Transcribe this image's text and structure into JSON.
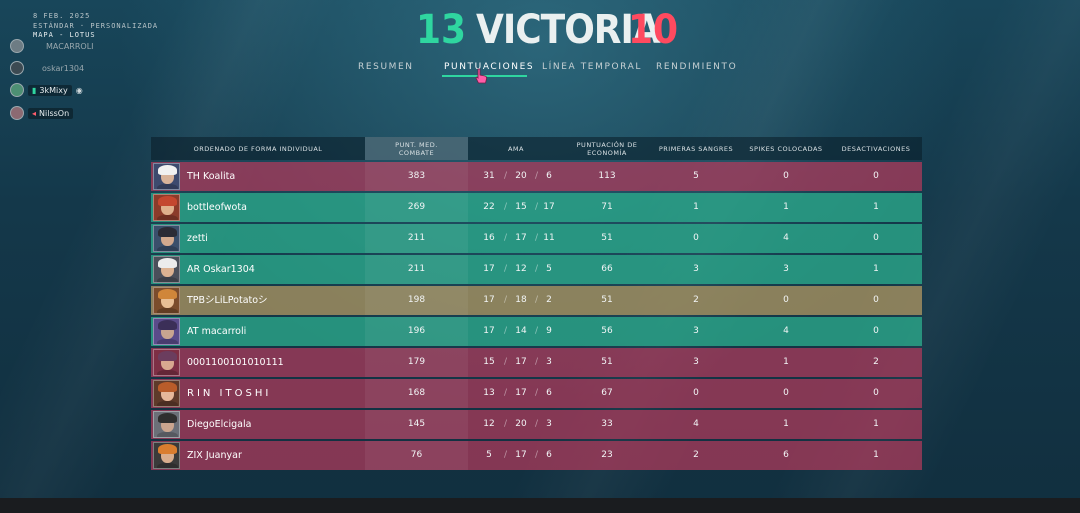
{
  "header": {
    "score_left": "13",
    "result": "VICTORIA",
    "score_right": "10",
    "date": "8 FEB. 2025",
    "mode": "ESTÁNDAR · PERSONALIZADA",
    "map": "MAPA - LOTUS"
  },
  "tabs": [
    {
      "label": "RESUMEN",
      "active": false
    },
    {
      "label": "PUNTUACIONES",
      "active": true
    },
    {
      "label": "LÍNEA TEMPORAL",
      "active": false
    },
    {
      "label": "RENDIMIENTO",
      "active": false
    }
  ],
  "feed": [
    {
      "name": "MACARROLI"
    },
    {
      "name": "oskar1304"
    },
    {
      "name": "3kMixy"
    },
    {
      "name": "NilssOn"
    }
  ],
  "columns": [
    "ORDENADO DE FORMA INDIVIDUAL",
    "PUNT. MED. COMBATE",
    "AMA",
    "PUNTUACIÓN DE ECONOMÍA",
    "PRIMERAS SANGRES",
    "SPIKES COLOCADAS",
    "DESACTIVACIONES"
  ],
  "colors": {
    "ally": "#2caa8c",
    "enemy": "#b23a5c",
    "self": "#a89260",
    "accent_green": "#2fd6a0",
    "accent_red": "#ff4a5f"
  },
  "rows": [
    {
      "name": "TH Koalita",
      "team": "enemy",
      "acs": "383",
      "k": "31",
      "d": "20",
      "a": "6",
      "econ": "113",
      "fb": "5",
      "plants": "0",
      "defuses": "0"
    },
    {
      "name": "bottleofwota",
      "team": "ally",
      "acs": "269",
      "k": "22",
      "d": "15",
      "a": "17",
      "econ": "71",
      "fb": "1",
      "plants": "1",
      "defuses": "1"
    },
    {
      "name": "zetti",
      "team": "ally",
      "acs": "211",
      "k": "16",
      "d": "17",
      "a": "11",
      "econ": "51",
      "fb": "0",
      "plants": "4",
      "defuses": "0"
    },
    {
      "name": "AR Oskar1304",
      "team": "ally",
      "acs": "211",
      "k": "17",
      "d": "12",
      "a": "5",
      "econ": "66",
      "fb": "3",
      "plants": "3",
      "defuses": "1"
    },
    {
      "name": "TPBシLiLPotatoシ",
      "team": "self",
      "acs": "198",
      "k": "17",
      "d": "18",
      "a": "2",
      "econ": "51",
      "fb": "2",
      "plants": "0",
      "defuses": "0"
    },
    {
      "name": "AT macarroli",
      "team": "ally",
      "acs": "196",
      "k": "17",
      "d": "14",
      "a": "9",
      "econ": "56",
      "fb": "3",
      "plants": "4",
      "defuses": "0"
    },
    {
      "name": "0001100101010111",
      "team": "enemy",
      "acs": "179",
      "k": "15",
      "d": "17",
      "a": "3",
      "econ": "51",
      "fb": "3",
      "plants": "1",
      "defuses": "2"
    },
    {
      "name": "RIN ITOSHI",
      "team": "enemy",
      "acs": "168",
      "k": "13",
      "d": "17",
      "a": "6",
      "econ": "67",
      "fb": "0",
      "plants": "0",
      "defuses": "0"
    },
    {
      "name": "DiegoElcigala",
      "team": "enemy",
      "acs": "145",
      "k": "12",
      "d": "20",
      "a": "3",
      "econ": "33",
      "fb": "4",
      "plants": "1",
      "defuses": "1"
    },
    {
      "name": "ZIX Juanyar",
      "team": "enemy",
      "acs": "76",
      "k": "5",
      "d": "17",
      "a": "6",
      "econ": "23",
      "fb": "2",
      "plants": "6",
      "defuses": "1"
    }
  ]
}
